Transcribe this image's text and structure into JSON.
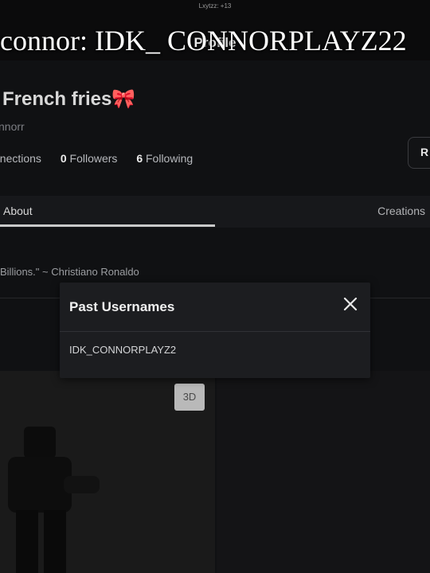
{
  "status_bar": {
    "text": "Lxytzz: +13"
  },
  "header": {
    "title": "Profile"
  },
  "overlay_caption": "connor: IDK_ CONNORPLAYZ22",
  "profile": {
    "display_name": "French fries",
    "display_name_emoji": "🎀",
    "username": "nnorr",
    "stats": {
      "connections_label": "nnections",
      "followers_count": "0",
      "followers_label": "Followers",
      "following_count": "6",
      "following_label": "Following"
    },
    "action_button_partial": "R"
  },
  "tabs": [
    {
      "label": "About",
      "active": true
    },
    {
      "label": "Creations",
      "active": false
    }
  ],
  "about": {
    "bio": "Billions.\" ~ Christiano Ronaldo"
  },
  "avatar": {
    "view_button": "3D"
  },
  "modal": {
    "title": "Past Usernames",
    "close_icon": "close-icon",
    "items": [
      "IDK_CONNORPLAYZ2"
    ]
  }
}
